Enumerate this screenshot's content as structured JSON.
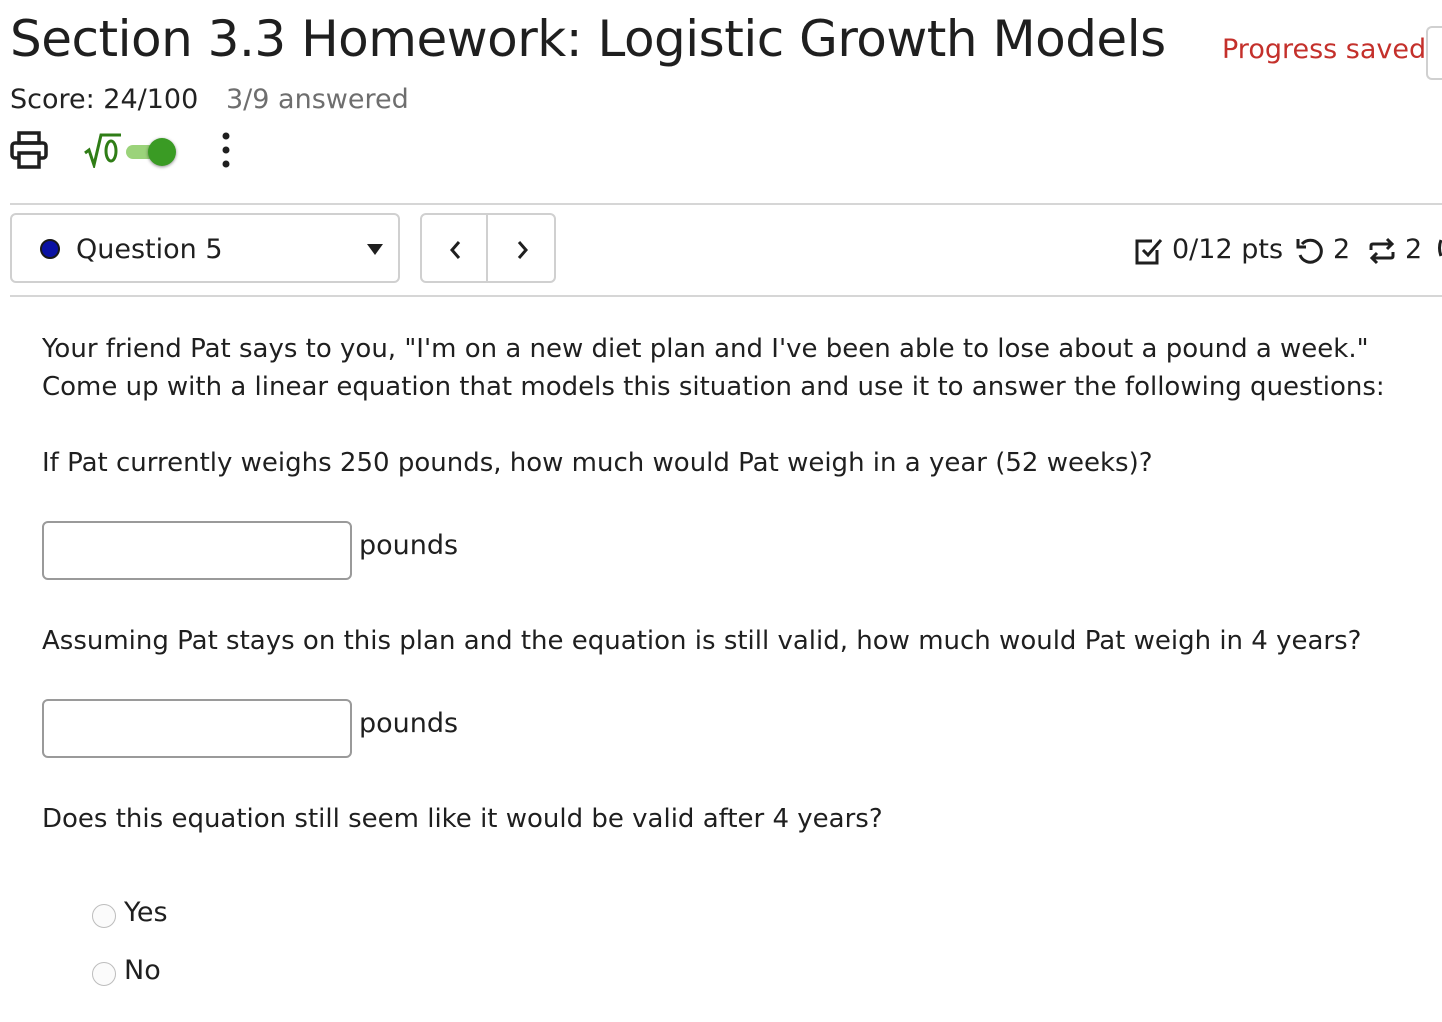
{
  "header": {
    "title": "Section 3.3 Homework: Logistic Growth Models",
    "progress_text": "Progress saved",
    "score": "Score: 24/100",
    "answered": "3/9 answered"
  },
  "toolbar": {
    "print_icon": "printer-icon",
    "math_toggle_icon": "sqrt-icon",
    "math_toggle_on": true,
    "more_icon": "vertical-dots-icon"
  },
  "question_nav": {
    "selected": "Question 5",
    "prev_icon": "chevron-left-icon",
    "next_icon": "chevron-right-icon",
    "points": "0/12 pts",
    "retries": "2",
    "regenerations": "2"
  },
  "question": {
    "intro": "Your friend Pat says to you, \"I'm on a new diet plan and I've been able to lose about a pound a week.\" Come up with a linear equation that models this situation and use it to answer the following questions:",
    "part1": "If Pat currently weighs 250 pounds, how much would Pat weigh in a year (52 weeks)?",
    "part1_value": "",
    "part1_unit": "pounds",
    "part2": "Assuming Pat stays on this plan and the equation is still valid, how much would Pat weigh in 4 years?",
    "part2_value": "",
    "part2_unit": "pounds",
    "part3": "Does this equation still seem like it would be valid after 4 years?",
    "options": [
      "Yes",
      "No"
    ]
  },
  "colors": {
    "progress_red": "#c4302b",
    "toggle_green": "#3a9b24",
    "toggle_track": "#9bd37a",
    "sqrt_green": "#2f7d16",
    "question_dot": "#0b12a3"
  }
}
